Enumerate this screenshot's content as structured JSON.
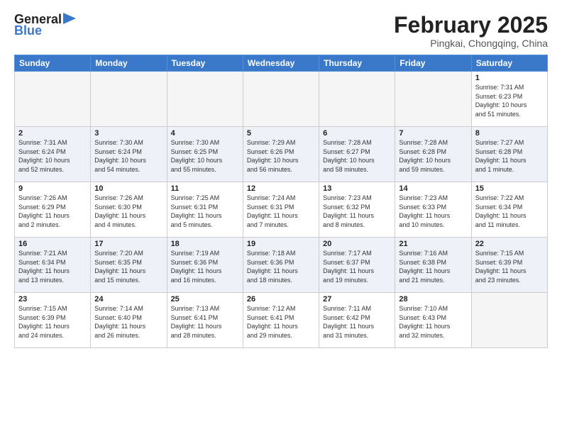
{
  "header": {
    "logo": {
      "line1": "General",
      "line2": "Blue"
    },
    "title": "February 2025",
    "subtitle": "Pingkai, Chongqing, China"
  },
  "weekdays": [
    "Sunday",
    "Monday",
    "Tuesday",
    "Wednesday",
    "Thursday",
    "Friday",
    "Saturday"
  ],
  "weeks": [
    [
      {
        "day": "",
        "info": ""
      },
      {
        "day": "",
        "info": ""
      },
      {
        "day": "",
        "info": ""
      },
      {
        "day": "",
        "info": ""
      },
      {
        "day": "",
        "info": ""
      },
      {
        "day": "",
        "info": ""
      },
      {
        "day": "1",
        "info": "Sunrise: 7:31 AM\nSunset: 6:23 PM\nDaylight: 10 hours\nand 51 minutes."
      }
    ],
    [
      {
        "day": "2",
        "info": "Sunrise: 7:31 AM\nSunset: 6:24 PM\nDaylight: 10 hours\nand 52 minutes."
      },
      {
        "day": "3",
        "info": "Sunrise: 7:30 AM\nSunset: 6:24 PM\nDaylight: 10 hours\nand 54 minutes."
      },
      {
        "day": "4",
        "info": "Sunrise: 7:30 AM\nSunset: 6:25 PM\nDaylight: 10 hours\nand 55 minutes."
      },
      {
        "day": "5",
        "info": "Sunrise: 7:29 AM\nSunset: 6:26 PM\nDaylight: 10 hours\nand 56 minutes."
      },
      {
        "day": "6",
        "info": "Sunrise: 7:28 AM\nSunset: 6:27 PM\nDaylight: 10 hours\nand 58 minutes."
      },
      {
        "day": "7",
        "info": "Sunrise: 7:28 AM\nSunset: 6:28 PM\nDaylight: 10 hours\nand 59 minutes."
      },
      {
        "day": "8",
        "info": "Sunrise: 7:27 AM\nSunset: 6:28 PM\nDaylight: 11 hours\nand 1 minute."
      }
    ],
    [
      {
        "day": "9",
        "info": "Sunrise: 7:26 AM\nSunset: 6:29 PM\nDaylight: 11 hours\nand 2 minutes."
      },
      {
        "day": "10",
        "info": "Sunrise: 7:26 AM\nSunset: 6:30 PM\nDaylight: 11 hours\nand 4 minutes."
      },
      {
        "day": "11",
        "info": "Sunrise: 7:25 AM\nSunset: 6:31 PM\nDaylight: 11 hours\nand 5 minutes."
      },
      {
        "day": "12",
        "info": "Sunrise: 7:24 AM\nSunset: 6:31 PM\nDaylight: 11 hours\nand 7 minutes."
      },
      {
        "day": "13",
        "info": "Sunrise: 7:23 AM\nSunset: 6:32 PM\nDaylight: 11 hours\nand 8 minutes."
      },
      {
        "day": "14",
        "info": "Sunrise: 7:23 AM\nSunset: 6:33 PM\nDaylight: 11 hours\nand 10 minutes."
      },
      {
        "day": "15",
        "info": "Sunrise: 7:22 AM\nSunset: 6:34 PM\nDaylight: 11 hours\nand 11 minutes."
      }
    ],
    [
      {
        "day": "16",
        "info": "Sunrise: 7:21 AM\nSunset: 6:34 PM\nDaylight: 11 hours\nand 13 minutes."
      },
      {
        "day": "17",
        "info": "Sunrise: 7:20 AM\nSunset: 6:35 PM\nDaylight: 11 hours\nand 15 minutes."
      },
      {
        "day": "18",
        "info": "Sunrise: 7:19 AM\nSunset: 6:36 PM\nDaylight: 11 hours\nand 16 minutes."
      },
      {
        "day": "19",
        "info": "Sunrise: 7:18 AM\nSunset: 6:36 PM\nDaylight: 11 hours\nand 18 minutes."
      },
      {
        "day": "20",
        "info": "Sunrise: 7:17 AM\nSunset: 6:37 PM\nDaylight: 11 hours\nand 19 minutes."
      },
      {
        "day": "21",
        "info": "Sunrise: 7:16 AM\nSunset: 6:38 PM\nDaylight: 11 hours\nand 21 minutes."
      },
      {
        "day": "22",
        "info": "Sunrise: 7:15 AM\nSunset: 6:39 PM\nDaylight: 11 hours\nand 23 minutes."
      }
    ],
    [
      {
        "day": "23",
        "info": "Sunrise: 7:15 AM\nSunset: 6:39 PM\nDaylight: 11 hours\nand 24 minutes."
      },
      {
        "day": "24",
        "info": "Sunrise: 7:14 AM\nSunset: 6:40 PM\nDaylight: 11 hours\nand 26 minutes."
      },
      {
        "day": "25",
        "info": "Sunrise: 7:13 AM\nSunset: 6:41 PM\nDaylight: 11 hours\nand 28 minutes."
      },
      {
        "day": "26",
        "info": "Sunrise: 7:12 AM\nSunset: 6:41 PM\nDaylight: 11 hours\nand 29 minutes."
      },
      {
        "day": "27",
        "info": "Sunrise: 7:11 AM\nSunset: 6:42 PM\nDaylight: 11 hours\nand 31 minutes."
      },
      {
        "day": "28",
        "info": "Sunrise: 7:10 AM\nSunset: 6:43 PM\nDaylight: 11 hours\nand 32 minutes."
      },
      {
        "day": "",
        "info": ""
      }
    ]
  ],
  "shaded_rows": [
    1,
    3
  ],
  "colors": {
    "header_bg": "#3a78c9",
    "shaded_cell": "#eef2f8",
    "empty_cell": "#f5f5f5"
  }
}
